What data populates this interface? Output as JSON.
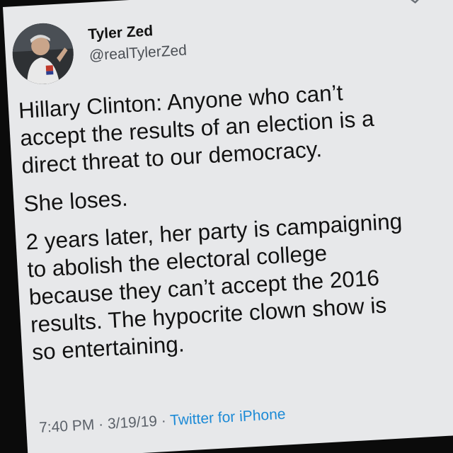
{
  "author": {
    "display_name": "Tyler Zed",
    "handle": "@realTylerZed"
  },
  "tweet": {
    "paragraphs": [
      "Hillary Clinton: Anyone who can’t\naccept the results of an election is a\ndirect threat to our democracy.",
      "She loses.",
      "2 years later, her party is campaigning\nto abolish the electoral college\nbecause they can’t accept the 2016\nresults. The hypocrite clown show is\nso entertaining."
    ]
  },
  "meta": {
    "time": "7:40 PM",
    "separator": " · ",
    "date": "3/19/19",
    "source": "Twitter for iPhone"
  },
  "icons": {
    "menu": "chevron-down-icon",
    "avatar": "avatar"
  },
  "colors": {
    "card_background": "#e7e8ea",
    "source_link": "#1c8ad6",
    "muted_text": "#5b6169"
  }
}
